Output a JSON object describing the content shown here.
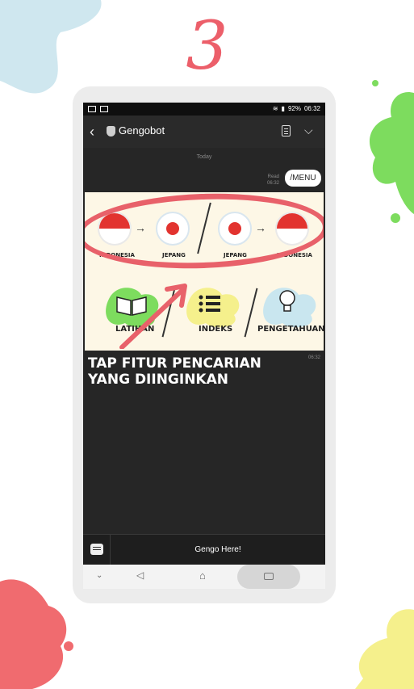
{
  "step": "3",
  "statusbar": {
    "battery": "92%",
    "time": "06:32"
  },
  "header": {
    "title": "Gengobot"
  },
  "chat": {
    "date_label": "Today",
    "read_label": "Read",
    "read_time": "06:32",
    "user_message": "/MENU",
    "card": {
      "label_1": "INDONESIA",
      "label_2": "JEPANG",
      "label_3": "JEPANG",
      "label_4": "INDONESIA",
      "menu_latihan": "LATIHAN",
      "menu_indeks": "INDEKS",
      "menu_pengetahuan": "PENGETAHUAN"
    },
    "caption_line1": "TAP FITUR PENCARIAN",
    "caption_line2": "YANG DIINGINKAN",
    "caption_time": "06:32"
  },
  "input": {
    "text": "Gengo Here!"
  },
  "colors": {
    "accent": "#e8616a",
    "blob_green": "#7ddc5e",
    "blob_yellow": "#f5f08c",
    "blob_blue": "#c9e6ef"
  }
}
